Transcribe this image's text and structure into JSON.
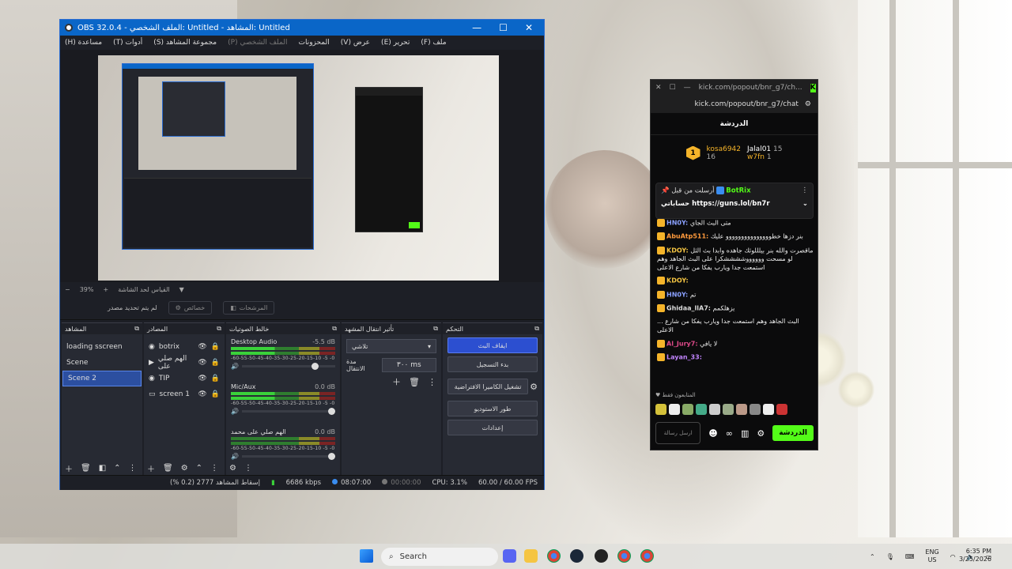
{
  "obs": {
    "title": "OBS 32.0.4 - الملف الشخصي: Untitled - المشاهد: Untitled",
    "controls": {
      "minimize": "—",
      "maximize": "☐",
      "close": "✕"
    },
    "menu": [
      "ملف (F)",
      "تحرير (E)",
      "عرض (V)",
      "المحزونات",
      "الملف الشخصي (P)",
      "مجموعة المشاهد (S)",
      "أدوات (T)",
      "مساعدة (H)"
    ],
    "zoom": {
      "value": "39%",
      "label": "القياس لحد الشاشة"
    },
    "source_bar": {
      "no_source": "لم يتم تحديد مصدر",
      "properties": "خصائص",
      "filters": "المرشحات"
    },
    "docks": {
      "scenes": {
        "title": "المشاهد",
        "items": [
          "loading sscreen",
          "Scene",
          "Scene 2"
        ],
        "selected_index": 2
      },
      "sources": {
        "title": "المصادر",
        "items": [
          "botrix",
          "الهم صلي على",
          "TIP",
          "screen 1"
        ]
      },
      "mixer": {
        "title": "خالط الصوتيات",
        "channels": [
          {
            "name": "Desktop Audio",
            "db": "-5.5 dB",
            "volume": 0.85
          },
          {
            "name": "Mic/Aux",
            "db": "0.0 dB",
            "volume": 1.0
          },
          {
            "name": "الهم صلي على محمد",
            "db": "0.0 dB",
            "volume": 1.0
          }
        ],
        "ticks": "-60-55-50-45-40-35-30-25-20-15-10 -5 -0"
      },
      "transitions": {
        "title": "تأثير انتقال المشهد",
        "selected": "تلاشي",
        "duration_label": "مدة الانتقال",
        "duration": "٣٠٠ ms"
      },
      "controls": {
        "title": "التحكم",
        "buttons": [
          "ايقاف البث",
          "بدء التسجيل",
          "تشغيل الكاميرا الافتراضية",
          "طور الاستوديو",
          "إعدادات"
        ]
      }
    },
    "status": {
      "dropped": "إسقاط المشاهد 2777 (0.2 %)",
      "bitrate": "6686 kbps",
      "stream_time": "08:07:00",
      "rec_time": "00:00:00",
      "cpu": "CPU: 3.1%",
      "fps": "60.00 / 60.00 FPS"
    },
    "colors": {
      "titlebar": "#0a66c8",
      "selected": "#2c4fa0",
      "primary_button": "#2c4fd0"
    }
  },
  "kick": {
    "url": "kick.com/popout/bnr_g7/ch...",
    "url_full": "kick.com/popout/bnr_g7/chat",
    "header": "الدردشة",
    "leaderboard": [
      {
        "rank": "1",
        "name": "kosa6942",
        "count": "16"
      },
      {
        "name": "Jalal01",
        "count": "15"
      },
      {
        "name": "w7fn",
        "count": "1"
      }
    ],
    "pinned": {
      "by": "أرسلت من قبل",
      "user": "BotRix",
      "text": "حساباتي https://guns.lol/bn7r"
    },
    "messages": [
      {
        "user": "HN0Y:",
        "text": "متى البث الجاي",
        "color": "#8aa0ff"
      },
      {
        "user": "AbuAtp511:",
        "text": "بنر دزها خطووووووووووووووو عليك",
        "color": "#ff9a3c"
      },
      {
        "user": "KDOY:",
        "text": "ماقصرت والله بنر بيلللوثك جاهده وابدا بث الثل لو مسحت ووووووششششكرا على البث الجاهد وهم استمعت جدا ويارب يفكا من شارع الاعلى",
        "color": "#f5c542"
      },
      {
        "user": "KDOY:",
        "text": "",
        "color": "#f5c542"
      },
      {
        "user": "HN0Y:",
        "text": "تم",
        "color": "#8aa0ff"
      },
      {
        "user": "Ghidaa_llA7:",
        "text": "يزهلكمم",
        "color": "#dddddd"
      },
      {
        "user": "",
        "text": "... البث الجاهد وهم استمعت جدا ويارب يفكا من شارع الاعلى",
        "color": "#999999"
      },
      {
        "user": "Al_Jury7:",
        "text": "لا يافي",
        "color": "#e04a8a"
      },
      {
        "user": "Layan_33:",
        "text": "",
        "color": "#c084fc"
      }
    ],
    "subscribers_label": "المتابعون فقط",
    "input_placeholder": "ارسل رسالة",
    "send": "الدردشة",
    "colors": {
      "brand": "#53fc18",
      "bg": "#0b0b0c"
    }
  },
  "taskbar": {
    "search": "Search",
    "lang": "ENG",
    "region": "US",
    "time": "6:35 PM",
    "date": "3/25/2026"
  }
}
